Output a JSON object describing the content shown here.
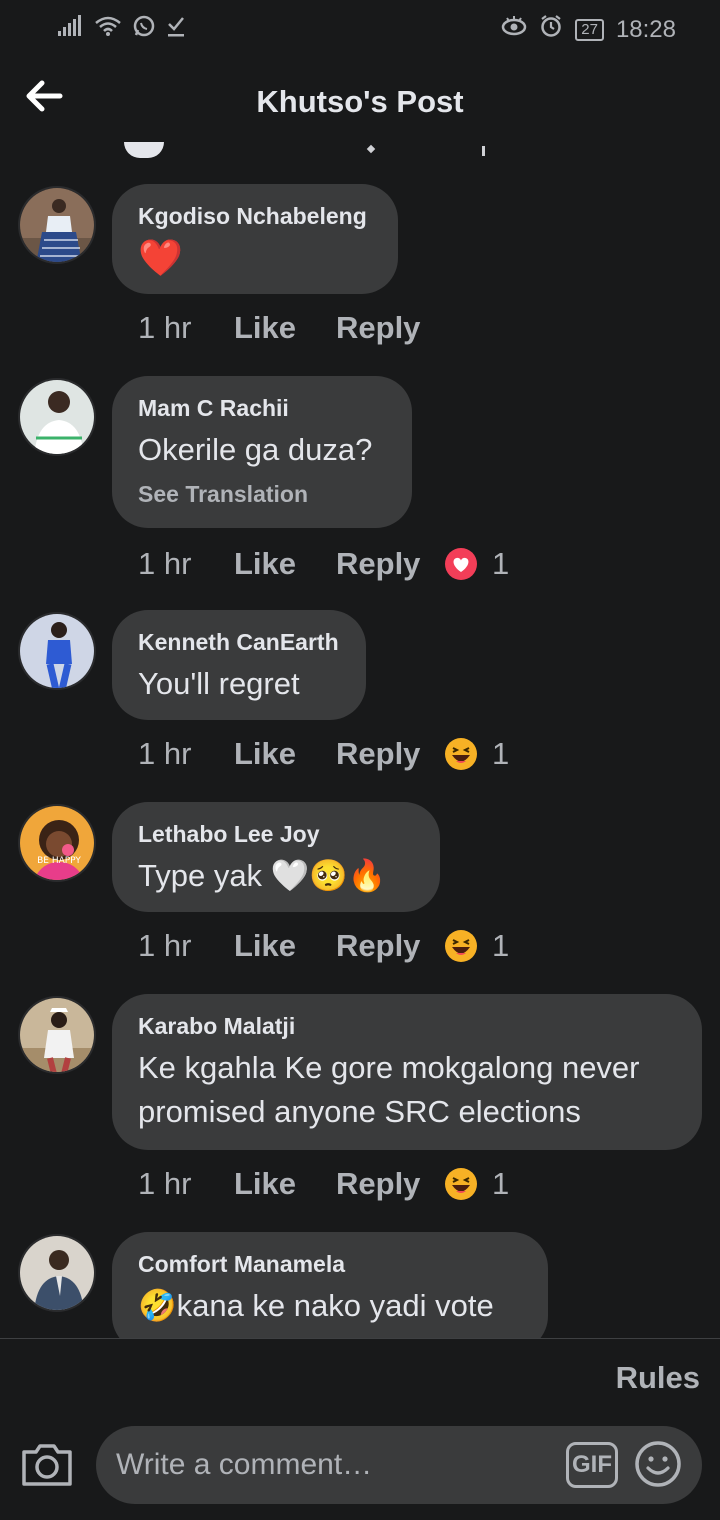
{
  "status_bar": {
    "battery": "27",
    "time": "18:28"
  },
  "header": {
    "title": "Khutso's Post"
  },
  "comments": [
    {
      "author": "Kgodiso Nchabeleng",
      "text": "❤️",
      "time": "1 hr",
      "like": "Like",
      "reply": "Reply"
    },
    {
      "author": "Mam C Rachii",
      "text": "Okerile ga duza?",
      "translate": "See Translation",
      "time": "1 hr",
      "like": "Like",
      "reply": "Reply",
      "reaction": "love",
      "reaction_count": "1"
    },
    {
      "author": "Kenneth CanEarth",
      "text": "You'll regret",
      "time": "1 hr",
      "like": "Like",
      "reply": "Reply",
      "reaction": "haha",
      "reaction_count": "1"
    },
    {
      "author": "Lethabo Lee Joy",
      "text": "Type yak 🤍🥺🔥",
      "avatar_caption": "BE HAPPY",
      "time": "1 hr",
      "like": "Like",
      "reply": "Reply",
      "reaction": "haha",
      "reaction_count": "1"
    },
    {
      "author": "Karabo Malatji",
      "text_line1": "Ke kgahla Ke gore mokgalong never",
      "text_line2": "promised anyone SRC elections",
      "time": "1 hr",
      "like": "Like",
      "reply": "Reply",
      "reaction": "haha",
      "reaction_count": "1"
    },
    {
      "author": "Comfort Manamela",
      "text": "🤣kana ke nako yadi vote"
    }
  ],
  "footer": {
    "rules": "Rules",
    "placeholder": "Write a comment…",
    "gif_label": "GIF"
  },
  "colors": {
    "background": "#18191a",
    "bubble": "#3a3b3c",
    "secondary_text": "#b0b3b8",
    "love": "#f33e58",
    "haha": "#f7b125"
  }
}
